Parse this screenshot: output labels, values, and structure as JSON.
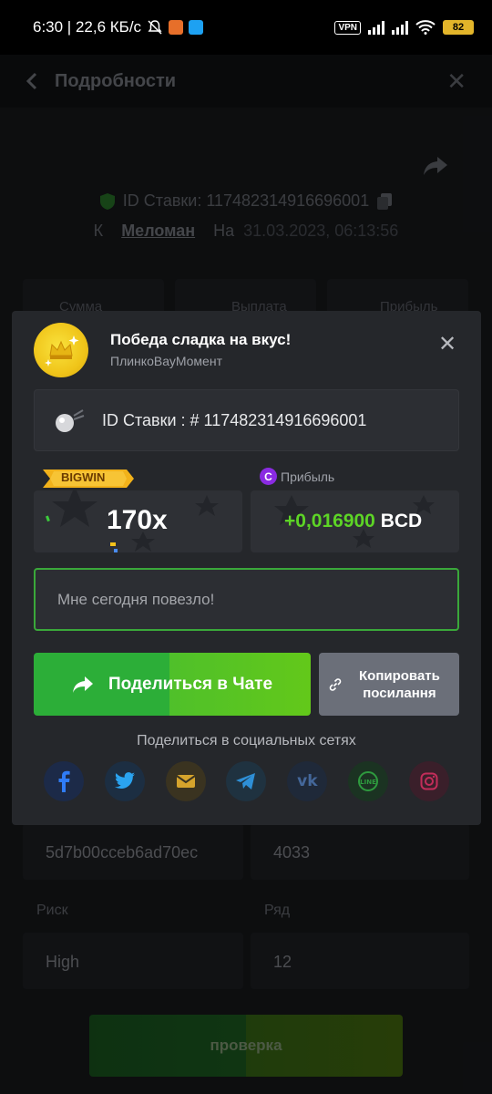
{
  "status_bar": {
    "time_speed": "6:30 | 22,6 КБ/с",
    "vpn": "VPN",
    "battery": "82"
  },
  "background": {
    "header_title": "Подробности",
    "bet_id": "ID Ставки: 117482314916696001",
    "prefix_k": "К",
    "user": "Меломан",
    "on": "На",
    "datetime": "31.03.2023, 06:13:56",
    "tile_labels": [
      "Сумма",
      "Выплата",
      "Прибыль"
    ],
    "hash": "5d7b00cceb6ad70ec",
    "nonce": "4033",
    "risk_label": "Риск",
    "risk_value": "High",
    "rows_label": "Ряд",
    "rows_value": "12",
    "verify_label": "проверка"
  },
  "modal": {
    "title": "Победа сладка на вкус!",
    "subtitle": "ПлинкоВауМомент",
    "bet_id": "ID Ставки : # 117482314916696001",
    "bigwin_badge": "BIGWIN",
    "multiplier": "170x",
    "profit_label": "Прибыль",
    "profit_value": "+0,016900",
    "currency": "BCD",
    "message_placeholder": "Мне сегодня повезло!",
    "share_chat_label": "Поделиться в Чате",
    "copy_link_line1": "Копировать",
    "copy_link_line2": "посилання",
    "social_title": "Поделиться в социальных сетях",
    "socials": [
      "facebook",
      "twitter",
      "email",
      "telegram",
      "vk",
      "line",
      "instagram"
    ]
  },
  "colors": {
    "accent_green": "#5dd426",
    "modal_bg": "#25272b",
    "copy_btn": "#6b6f79"
  }
}
